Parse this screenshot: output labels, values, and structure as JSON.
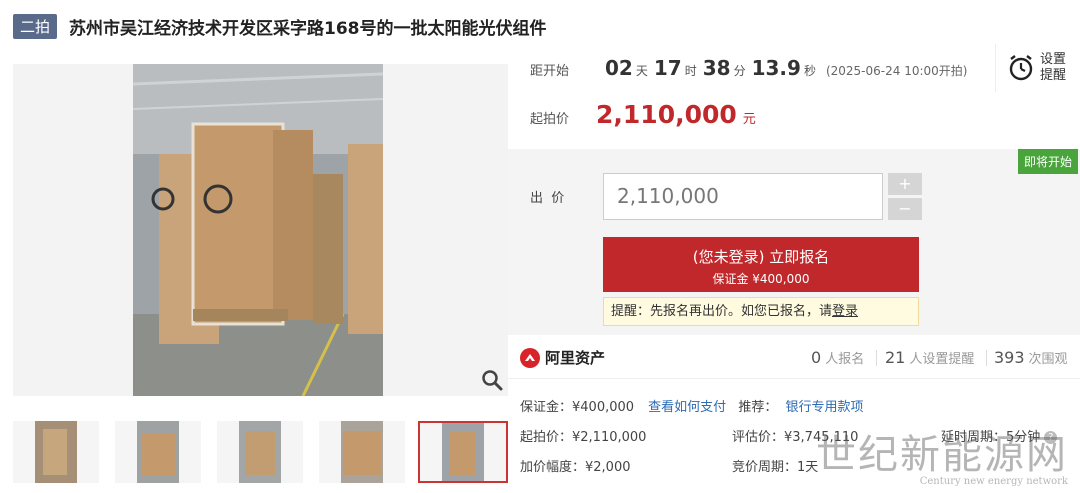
{
  "title": {
    "round_badge": "二拍",
    "text": "苏州市吴江经济技术开发区采字路168号的一批太阳能光伏组件"
  },
  "countdown": {
    "label": "距开始",
    "days": "02",
    "days_unit": "天",
    "hours": "17",
    "hours_unit": "时",
    "minutes": "38",
    "minutes_unit": "分",
    "seconds": "13.9",
    "seconds_unit": "秒",
    "start_note": "(2025-06-24 10:00开拍)"
  },
  "remind": {
    "label": "设置提醒",
    "icon": "alarm-clock-icon"
  },
  "starting_price": {
    "label": "起拍价",
    "value": "2,110,000",
    "unit": "元"
  },
  "bid": {
    "status_tag": "即将开始",
    "label": "出  价",
    "input_value": "2,110,000",
    "plus": "+",
    "minus": "−",
    "signup_main": "(您未登录) 立即报名",
    "signup_sub": "保证金 ¥400,000",
    "tip_prefix": "提醒：先报名再出价。如您已报名，请",
    "tip_link": "登录"
  },
  "stats": {
    "brand": "阿里资产",
    "applicants_num": "0",
    "applicants_label": "人报名",
    "reminders_num": "21",
    "reminders_label": "人设置提醒",
    "views_num": "393",
    "views_label": "次围观"
  },
  "info": {
    "deposit_label": "保证金：¥400,000",
    "how_to_pay": "查看如何支付",
    "recommend_label": "推荐：",
    "recommend_link": "银行专用款项",
    "start_price": "起拍价：¥2,110,000",
    "appraisal": "评估价：¥3,745,110",
    "delay_period": "延时周期：5分钟",
    "increment": "加价幅度：¥2,000",
    "bid_cycle": "竞价周期：1天"
  },
  "watermark": {
    "cn": "世纪新能源网",
    "en": "Century new energy network"
  },
  "colors": {
    "accent_red": "#c0282c",
    "status_green": "#48a43b",
    "link_blue": "#2d6bb3",
    "badge_gray_blue": "#5a6a8a"
  }
}
